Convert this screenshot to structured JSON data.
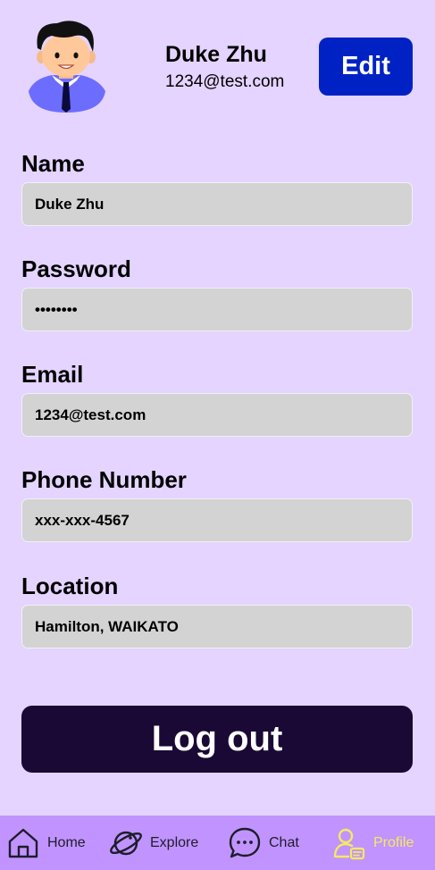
{
  "profile": {
    "name": "Duke Zhu",
    "email": "1234@test.com",
    "edit_label": "Edit"
  },
  "fields": [
    {
      "label": "Name",
      "value": "Duke Zhu"
    },
    {
      "label": "Password",
      "value": "••••••••"
    },
    {
      "label": "Email",
      "value": "1234@test.com"
    },
    {
      "label": "Phone Number",
      "value": "xxx-xxx-4567"
    },
    {
      "label": "Location",
      "value": "Hamilton, WAIKATO"
    }
  ],
  "logout_label": "Log out",
  "nav": {
    "items": [
      {
        "label": "Home",
        "icon": "home-icon"
      },
      {
        "label": "Explore",
        "icon": "planet-icon"
      },
      {
        "label": "Chat",
        "icon": "chat-icon"
      },
      {
        "label": "Profile",
        "icon": "profile-icon",
        "active": true
      }
    ]
  },
  "colors": {
    "background": "#e4d4ff",
    "edit_button": "#0022c4",
    "logout_button": "#1a0835",
    "nav_bar": "#c193ff",
    "active_nav": "#f5ea60",
    "field_box": "#d3d3d3"
  }
}
